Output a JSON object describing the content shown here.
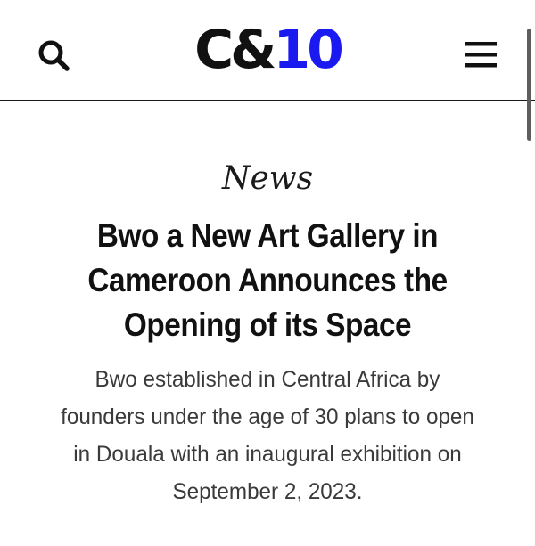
{
  "header": {
    "logo": {
      "main": "C&",
      "accent": "10",
      "accent_color": "#1a1af0"
    },
    "search_icon": "search-icon",
    "menu_icon": "hamburger-menu-icon"
  },
  "article": {
    "category": "News",
    "headline": "Bwo a New Art Gallery in Cameroon Announces the Opening of its Space",
    "summary": "Bwo established in Central Africa by founders under the age of 30 plans to open in Douala with an inaugural exhibition on September 2, 2023."
  }
}
